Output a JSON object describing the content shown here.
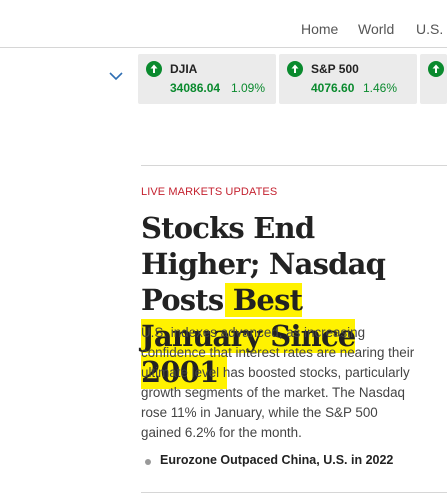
{
  "nav": {
    "items": [
      "Home",
      "World",
      "U.S."
    ]
  },
  "tickers": [
    {
      "name": "DJIA",
      "value": "34086.04",
      "change": "1.09%"
    },
    {
      "name": "S&P 500",
      "value": "4076.60",
      "change": "1.46%"
    }
  ],
  "article": {
    "kicker": "LIVE MARKETS UPDATES",
    "headline_plain": "Stocks End Higher; Nasdaq Posts ",
    "headline_highlighted": "Best January Since 2001",
    "summary": "U.S. indexes advanced, as increasing confidence that interest rates are nearing their ultimate level has boosted stocks, particularly growth segments of the market. The Nasdaq rose 11% in January, while the S&P 500 gained 6.2% for the month.",
    "related_link": "Eurozone Outpaced China, U.S. in 2022"
  },
  "colors": {
    "up_green": "#0a8a2e",
    "kicker_red": "#c4212f",
    "highlight_yellow": "#fff200",
    "ticker_bg": "#ebebeb"
  },
  "icons": {
    "ticker_up": "arrow-up-circle-icon",
    "expand": "chevron-down-icon"
  }
}
